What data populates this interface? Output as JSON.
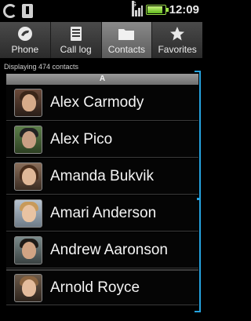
{
  "status_bar": {
    "time": "12:09",
    "network_letter": "G",
    "icons": [
      "sync-icon",
      "usb-icon",
      "signal-icon",
      "battery-icon"
    ],
    "battery_fill": 0.9
  },
  "tabs": [
    {
      "label": "Phone",
      "icon": "phone-icon",
      "selected": false
    },
    {
      "label": "Call log",
      "icon": "call-log-icon",
      "selected": false
    },
    {
      "label": "Contacts",
      "icon": "contacts-folder-icon",
      "selected": true
    },
    {
      "label": "Favorites",
      "icon": "star-icon",
      "selected": false
    }
  ],
  "contacts_count_text": "Displaying 474 contacts",
  "section_letter": "A",
  "contacts": [
    {
      "name": "Alex Carmody"
    },
    {
      "name": "Alex Pico"
    },
    {
      "name": "Amanda Bukvik"
    },
    {
      "name": "Amari Anderson"
    },
    {
      "name": "Andrew Aaronson"
    },
    {
      "name": "Arnold Royce"
    }
  ],
  "colors": {
    "accent": "#26a3e0",
    "selected_tab": "#7a7a7a",
    "battery": "#9be04a"
  }
}
